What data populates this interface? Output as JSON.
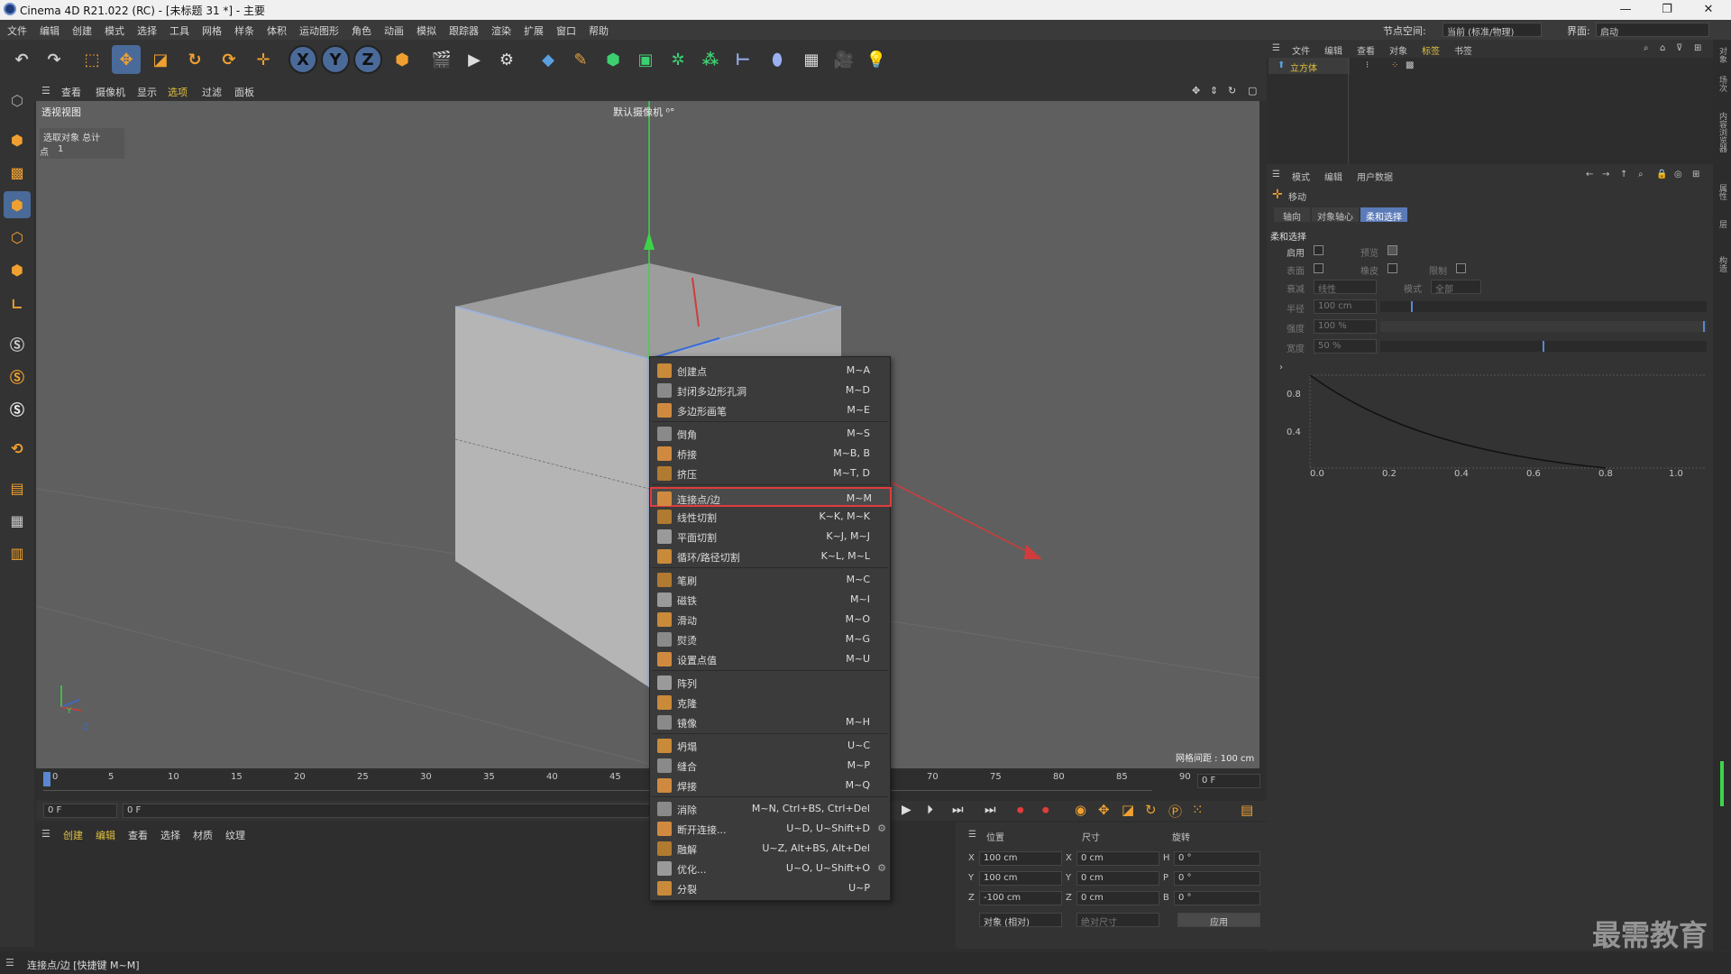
{
  "window": {
    "title": "Cinema 4D R21.022 (RC) - [未标题 31 *] - 主要",
    "min": "—",
    "max": "❐",
    "close": "✕"
  },
  "menubar": {
    "items": [
      "文件",
      "编辑",
      "创建",
      "模式",
      "选择",
      "工具",
      "网格",
      "样条",
      "体积",
      "运动图形",
      "角色",
      "动画",
      "模拟",
      "跟踪器",
      "渲染",
      "扩展",
      "窗口",
      "帮助"
    ],
    "node_space_label": "节点空间:",
    "node_space_value": "当前 (标准/物理)",
    "layout_label": "界面:",
    "layout_value": "启动"
  },
  "toolbar": {
    "axis_x": "X",
    "axis_y": "Y",
    "axis_z": "Z"
  },
  "viewport_menu": {
    "items": [
      "查看",
      "摄像机",
      "显示",
      "选项",
      "过滤",
      "面板"
    ]
  },
  "viewport": {
    "name": "透视视图",
    "camera": "默认摄像机 ⁰°",
    "info_header": "选取对象  总计",
    "info_row_label": "点",
    "info_row_value": "1",
    "grid_spacing": "网格间距 : 100 cm",
    "axis_y": "Y",
    "axis_z": "Z"
  },
  "context_menu": {
    "groups": [
      [
        {
          "label": "创建点",
          "shortcut": "M~A",
          "icon": "create-point-icon"
        },
        {
          "label": "封闭多边形孔洞",
          "shortcut": "M~D",
          "icon": "close-hole-icon"
        },
        {
          "label": "多边形画笔",
          "shortcut": "M~E",
          "icon": "polygon-pen-icon"
        }
      ],
      [
        {
          "label": "倒角",
          "shortcut": "M~S",
          "icon": "bevel-icon"
        },
        {
          "label": "桥接",
          "shortcut": "M~B, B",
          "icon": "bridge-icon"
        },
        {
          "label": "挤压",
          "shortcut": "M~T, D",
          "icon": "extrude-icon"
        }
      ],
      [
        {
          "label": "连接点/边",
          "shortcut": "M~M",
          "icon": "connect-points-edges-icon",
          "highlighted": true
        },
        {
          "label": "线性切割",
          "shortcut": "K~K, M~K",
          "icon": "line-cut-icon"
        },
        {
          "label": "平面切割",
          "shortcut": "K~J, M~J",
          "icon": "plane-cut-icon"
        },
        {
          "label": "循环/路径切割",
          "shortcut": "K~L, M~L",
          "icon": "loop-cut-icon"
        }
      ],
      [
        {
          "label": "笔刷",
          "shortcut": "M~C",
          "icon": "brush-icon"
        },
        {
          "label": "磁铁",
          "shortcut": "M~I",
          "icon": "magnet-icon"
        },
        {
          "label": "滑动",
          "shortcut": "M~O",
          "icon": "slide-icon"
        },
        {
          "label": "熨烫",
          "shortcut": "M~G",
          "icon": "iron-icon"
        },
        {
          "label": "设置点值",
          "shortcut": "M~U",
          "icon": "set-point-value-icon"
        }
      ],
      [
        {
          "label": "阵列",
          "shortcut": "",
          "icon": "array-icon"
        },
        {
          "label": "克隆",
          "shortcut": "",
          "icon": "clone-icon"
        },
        {
          "label": "镜像",
          "shortcut": "M~H",
          "icon": "mirror-icon"
        }
      ],
      [
        {
          "label": "坍塌",
          "shortcut": "U~C",
          "icon": "collapse-icon"
        },
        {
          "label": "缝合",
          "shortcut": "M~P",
          "icon": "stitch-icon"
        },
        {
          "label": "焊接",
          "shortcut": "M~Q",
          "icon": "weld-icon"
        }
      ],
      [
        {
          "label": "消除",
          "shortcut": "M~N, Ctrl+BS, Ctrl+Del",
          "icon": "dissolve-icon"
        },
        {
          "label": "断开连接...",
          "shortcut": "U~D, U~Shift+D",
          "icon": "disconnect-icon",
          "gear": true
        },
        {
          "label": "融解",
          "shortcut": "U~Z, Alt+BS, Alt+Del",
          "icon": "melt-icon"
        },
        {
          "label": "优化...",
          "shortcut": "U~O, U~Shift+O",
          "icon": "optimize-icon",
          "gear": true
        },
        {
          "label": "分裂",
          "shortcut": "U~P",
          "icon": "split-icon"
        }
      ]
    ]
  },
  "timeline": {
    "ticks": [
      "0",
      "5",
      "10",
      "15",
      "20",
      "25",
      "30",
      "35",
      "40",
      "45",
      "70",
      "75",
      "80",
      "85",
      "90"
    ],
    "current_frame": "0 F",
    "start_frame": "0 F",
    "end_field": "0 F",
    "range_label": "0 F"
  },
  "material_panel": {
    "menu": [
      "创建",
      "编辑",
      "查看",
      "选择",
      "材质",
      "纹理"
    ]
  },
  "coords": {
    "headers": [
      "位置",
      "尺寸",
      "旋转"
    ],
    "rows": [
      {
        "axis": "X",
        "pos": "100 cm",
        "size_axis": "X",
        "size": "0 cm",
        "rot_axis": "H",
        "rot": "0 °"
      },
      {
        "axis": "Y",
        "pos": "100 cm",
        "size_axis": "Y",
        "size": "0 cm",
        "rot_axis": "P",
        "rot": "0 °"
      },
      {
        "axis": "Z",
        "pos": "-100 cm",
        "size_axis": "Z",
        "size": "0 cm",
        "rot_axis": "B",
        "rot": "0 °"
      }
    ],
    "mode": "对象 (相对)",
    "size_mode": "绝对尺寸",
    "apply": "应用"
  },
  "object_manager": {
    "menu": [
      "文件",
      "编辑",
      "查看",
      "对象",
      "标签",
      "书签"
    ],
    "object_name": "立方体"
  },
  "attributes": {
    "menu": [
      "模式",
      "编辑",
      "用户数据"
    ],
    "tool_name": "移动",
    "tabs": [
      "轴向",
      "对象轴心",
      "柔和选择"
    ],
    "section": "柔和选择",
    "enable_label": "启用",
    "preview_label": "预览",
    "surface_label": "表面",
    "rubber_label": "橡皮",
    "restrict_label": "限制",
    "falloff_label": "衰减",
    "falloff_value": "线性",
    "mode_label": "模式",
    "mode_value": "全部",
    "radius_label": "半径",
    "radius_value": "100 cm",
    "strength_label": "强度",
    "strength_value": "100 %",
    "width_label": "宽度",
    "width_value": "50 %",
    "curve_y_ticks": [
      "0.8",
      "0.4",
      "0.0"
    ],
    "curve_x_ticks": [
      "0.2",
      "0.4",
      "0.6",
      "0.8",
      "1.0"
    ]
  },
  "side_tabs": [
    "对象",
    "场次",
    "内容浏览器",
    "层",
    "属性",
    "构造",
    "层"
  ],
  "status": {
    "text": "连接点/边 [快捷键 M~M]"
  },
  "watermark": "最需教育"
}
